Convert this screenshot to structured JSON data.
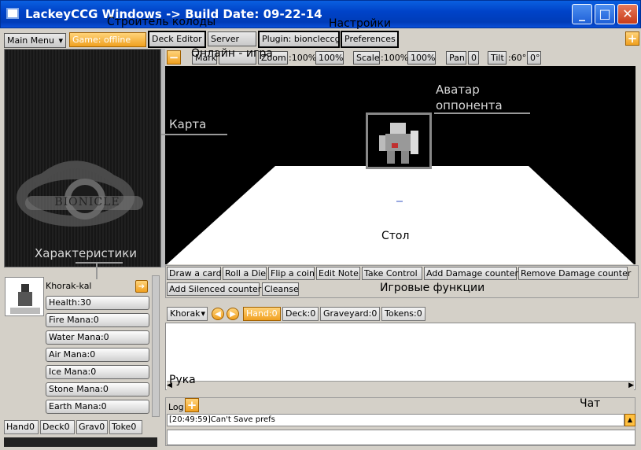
{
  "window": {
    "title": "LackeyCCG Windows -> Build Date: 09-22-14",
    "minimize": "_",
    "maximize": "□",
    "close": "✕"
  },
  "toolbar": {
    "main_menu": "Main Menu",
    "game_status": "Game: offline",
    "deck_editor": "Deck Editor",
    "server": "Server",
    "plugin": "Plugin: bioncleccg",
    "preferences": "Preferences",
    "add": "+"
  },
  "board_toolbar": {
    "minus": "−",
    "mark": "Mark",
    "zoom_label": "Zoom",
    "zoom_value": ":100%",
    "zoom_reset": "100%",
    "scale_label": "Scale",
    "scale_value": ":100%",
    "scale_reset": "100%",
    "pan_label": "Pan",
    "pan_value": "0",
    "tilt_label": "Tilt",
    "tilt_value": ":60°",
    "tilt_reset": "0°"
  },
  "card_preview": {
    "logo_text": "BIONICLE"
  },
  "player": {
    "name": "Khorak-kal",
    "stats": [
      "Health:30",
      "Fire Mana:0",
      "Water Mana:0",
      "Air Mana:0",
      "Ice Mana:0",
      "Stone Mana:0",
      "Earth Mana:0"
    ],
    "tabs": [
      "Hand0",
      "Deck0",
      "Grav0",
      "Toke0"
    ]
  },
  "functions": {
    "row1": [
      "Draw a card",
      "Roll a Die",
      "Flip a coin",
      "Edit Note",
      "Take Control",
      "Add Damage counter",
      "Remove Damage counter"
    ],
    "row2": [
      "Add Silenced counter",
      "Cleanse"
    ]
  },
  "hand": {
    "player_select": "Khorak",
    "tabs": [
      "Hand:0",
      "Deck:0",
      "Graveyard:0",
      "Tokens:0"
    ]
  },
  "log": {
    "label": "Log",
    "add": "+",
    "line": "[20:49:59]Can't Save prefs"
  },
  "annotations": {
    "deck_builder": "Строитель колоды",
    "settings": "Настройки",
    "online_game": "Онлайн - игра",
    "opponent_avatar_1": "Аватар",
    "opponent_avatar_2": "оппонента",
    "card": "Карта",
    "stats": "Характеристики",
    "table": "Стол",
    "game_functions": "Игровые функции",
    "hand": "Рука",
    "chat": "Чат"
  },
  "colors": {
    "titlebar": "#0043c8",
    "accent_orange": "#f0a020",
    "board": "#000000",
    "table": "#ffffff"
  }
}
